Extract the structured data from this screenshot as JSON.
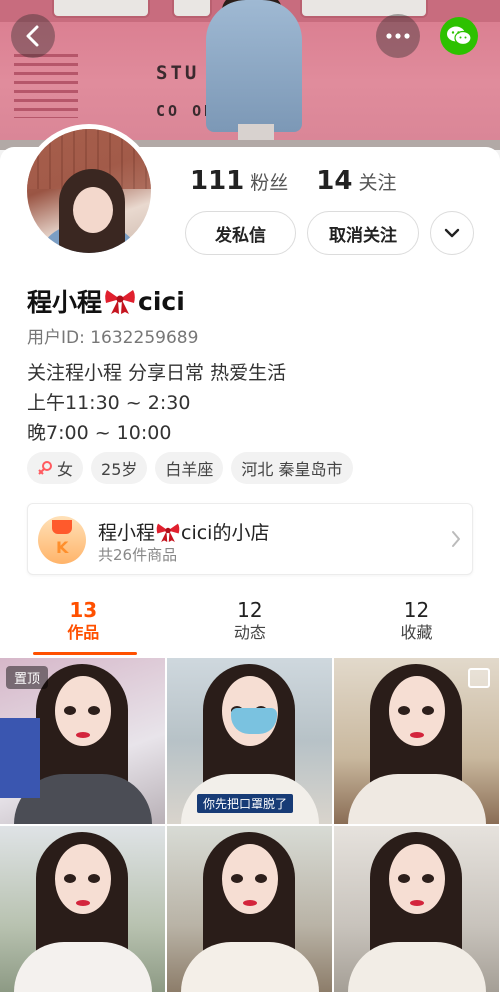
{
  "header": {
    "back_icon": "chevron-left-icon",
    "more_icon": "ellipsis-icon",
    "share_icon": "wechat-icon",
    "cover_sign_line1": "STU     NE",
    "cover_sign_line2": "CO ON"
  },
  "profile": {
    "followers_count": "111",
    "followers_label": "粉丝",
    "following_count": "14",
    "following_label": "关注",
    "message_button": "发私信",
    "unfollow_button": "取消关注",
    "name_prefix": "程小程",
    "name_suffix": "cici",
    "user_id": "用户ID: 1632259689",
    "bio_lines": [
      "关注程小程 分享日常 热爱生活",
      "上午11:30 ~ 2:30",
      "晚7:00 ~ 10:00"
    ],
    "tags": {
      "gender": "女",
      "age": "25岁",
      "zodiac": "白羊座",
      "location": "河北 秦皇岛市"
    }
  },
  "shop": {
    "title_prefix": "程小程",
    "title_suffix": "cici的小店",
    "subtitle": "共26件商品"
  },
  "tabs": [
    {
      "count": "13",
      "label": "作品",
      "active": true
    },
    {
      "count": "12",
      "label": "动态",
      "active": false
    },
    {
      "count": "12",
      "label": "收藏",
      "active": false
    }
  ],
  "grid": {
    "pinned_label": "置顶",
    "caption_text": "你先把口罩脱了"
  },
  "colors": {
    "accent": "#ff5000",
    "wechat": "#2dc100",
    "cover_pink": "#e08c9c"
  }
}
